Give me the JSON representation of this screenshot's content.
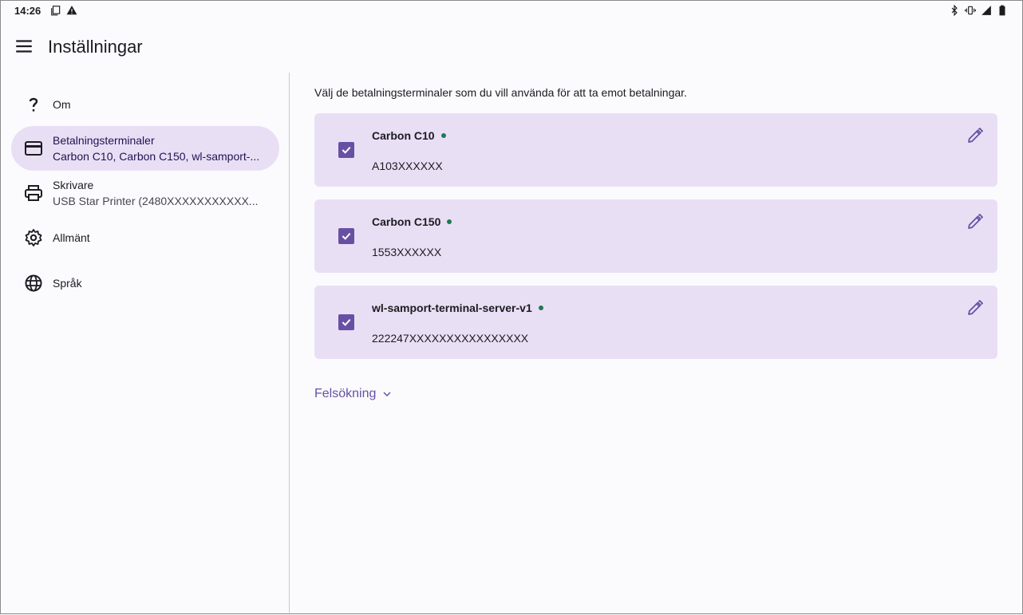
{
  "status_bar": {
    "time": "14:26",
    "left_icons": [
      "screenshot-icon",
      "warning-icon"
    ],
    "right_icons": [
      "bluetooth-icon",
      "vibrate-icon",
      "signal-icon",
      "battery-icon"
    ]
  },
  "app_bar": {
    "title": "Inställningar",
    "menu_icon": "menu-icon"
  },
  "sidebar": {
    "items": [
      {
        "icon": "help-icon",
        "label": "Om",
        "sub": "",
        "active": false
      },
      {
        "icon": "credit-card-icon",
        "label": "Betalningsterminaler",
        "sub": "Carbon C10, Carbon C150, wl-samport-...",
        "active": true
      },
      {
        "icon": "printer-icon",
        "label": "Skrivare",
        "sub": "USB Star Printer (2480XXXXXXXXXXX...",
        "active": false
      },
      {
        "icon": "gear-icon",
        "label": "Allmänt",
        "sub": "",
        "active": false
      },
      {
        "icon": "globe-icon",
        "label": "Språk",
        "sub": "",
        "active": false
      }
    ]
  },
  "main": {
    "intro": "Välj de betalningsterminaler som du vill använda för att ta emot betalningar.",
    "terminals": [
      {
        "name": "Carbon C10",
        "serial": "A103XXXXXX",
        "checked": true,
        "status": "online"
      },
      {
        "name": "Carbon C150",
        "serial": "1553XXXXXX",
        "checked": true,
        "status": "online"
      },
      {
        "name": "wl-samport-terminal-server-v1",
        "serial": "222247XXXXXXXXXXXXXXXX",
        "checked": true,
        "status": "online"
      }
    ],
    "troubleshoot_label": "Felsökning"
  },
  "colors": {
    "accent": "#6750a4",
    "active_bg": "#e9dff5",
    "status_online": "#1d7a55"
  }
}
